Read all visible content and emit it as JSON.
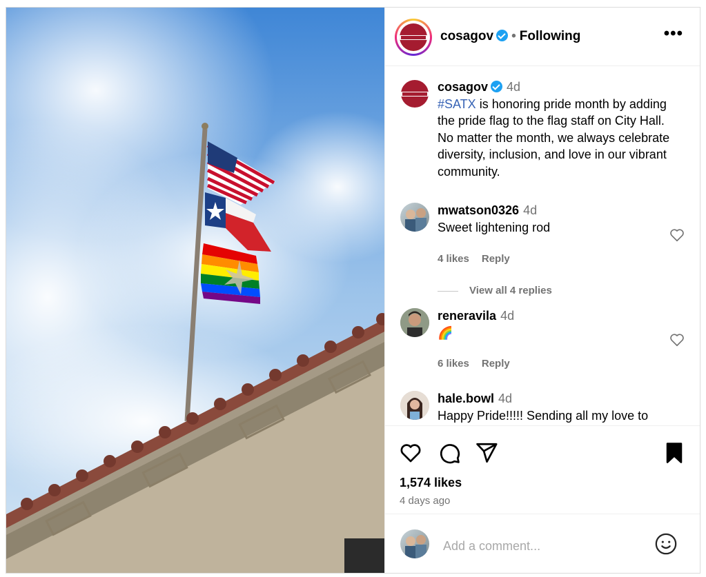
{
  "post": {
    "username": "cosagov",
    "follow_status": "Following",
    "separator": "•",
    "more_icon": "more-icon",
    "seal_text": "SAN ANTONIO"
  },
  "caption": {
    "username": "cosagov",
    "time": "4d",
    "hashtag": "#SATX",
    "text": " is honoring pride month by adding the pride flag to the flag staff on City Hall. No matter the month, we always celebrate diversity, inclusion, and love in our vibrant community."
  },
  "comments": [
    {
      "username": "mwatson0326",
      "time": "4d",
      "text": "Sweet lightening rod",
      "likes": "4 likes",
      "reply": "Reply"
    },
    {
      "username": "reneravila",
      "time": "4d",
      "text": "🌈",
      "likes": "6 likes",
      "reply": "Reply"
    },
    {
      "username": "hale.bowl",
      "time": "4d",
      "text": "Happy Pride!!!!! Sending all my love to"
    }
  ],
  "view_replies": "View all 4 replies",
  "actions": {
    "likes": "1,574 likes",
    "time_ago": "4 days ago"
  },
  "add_comment": {
    "placeholder": "Add a comment..."
  },
  "colors": {
    "brand_red": "#a51c30",
    "verified_blue": "#1da1f2",
    "hashtag_blue": "#3763b5",
    "muted_gray": "#737373"
  }
}
